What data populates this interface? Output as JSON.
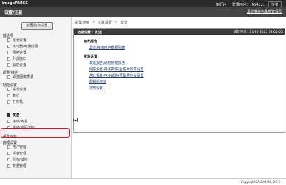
{
  "app": {
    "logo": "imagePRESS",
    "page_title": "设置/注册",
    "send_link": "发送维护到系统管理员",
    "links": [
      "到门户",
      "登录用户：7654321",
      "注销"
    ]
  },
  "sidebar": {
    "top_button": "返回前次设置",
    "sections": [
      {
        "label": "首选项",
        "items": [
          "纸张设置",
          "定时器/电量设置",
          "网络设置",
          "外部接口",
          "辅助设置"
        ]
      },
      {
        "label": "调整/维护",
        "items": [
          "调整图像质量"
        ]
      },
      {
        "label": "功能设置",
        "items": [
          "常规设置",
          "复印",
          "打印机",
          "发送",
          "接收/转发",
          "存储/访问文件"
        ]
      },
      {
        "label": "设置目标",
        "items": []
      },
      {
        "label": "管理设置",
        "items": [
          "用户管理",
          "设备管理",
          "授权/其他",
          "数据管理"
        ]
      }
    ],
    "active_item": "发送"
  },
  "main": {
    "breadcrumb": [
      "设置/注册",
      ">",
      "功能设置",
      ">",
      "发送"
    ],
    "panel_title": "功能设置：发送",
    "panel_status": "最近更新：07/16 2013 03:05:00",
    "section1_title": "输出报告",
    "section1_links": [
      "发送/接收用户数据列表"
    ],
    "section2_title": "常规设置",
    "section2_links": [
      "发送报告/通信管理报告",
      "网络设置-电子邮件/互联网传真设置",
      "通过设备-电子邮件/互联网传真设置",
      "限制新地址",
      "常用设置"
    ]
  },
  "footer": {
    "copyright": "Copyright CANON INC. 2013"
  }
}
